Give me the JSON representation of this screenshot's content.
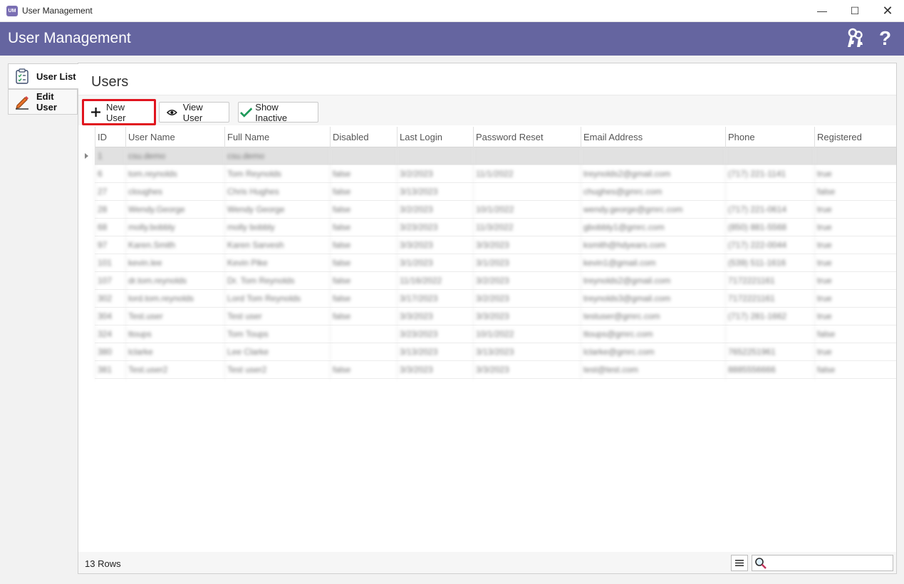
{
  "window": {
    "title": "User Management",
    "app_icon_text": "UM",
    "minimize_glyph": "—",
    "maximize_glyph": "☐",
    "close_glyph": "✕"
  },
  "header": {
    "title": "User Management",
    "keys_icon": "keys-icon",
    "help_glyph": "?"
  },
  "sidebar": {
    "tabs": [
      {
        "label": "User List",
        "icon": "clipboard-checklist-icon",
        "selected": true
      },
      {
        "label": "Edit User",
        "icon": "pencil-icon",
        "selected": false
      }
    ]
  },
  "main": {
    "title": "Users",
    "toolbar": {
      "new_user": "New User",
      "view_user": "View User",
      "show_inactive": "Show Inactive"
    },
    "columns": [
      "ID",
      "User Name",
      "Full Name",
      "Disabled",
      "Last Login",
      "Password Reset",
      "Email Address",
      "Phone",
      "Registered"
    ],
    "rows": [
      [
        "1",
        "csu.demo",
        "csu.demo",
        "",
        "",
        "",
        "",
        "",
        ""
      ],
      [
        "6",
        "tom.reynolds",
        "Tom Reynolds",
        "false",
        "3/2/2023",
        "11/1/2022",
        "treynolds2@gmail.com",
        "(717) 221-1141",
        "true"
      ],
      [
        "27",
        "cloughes",
        "Chris Hughes",
        "false",
        "3/13/2023",
        "",
        "chughes@gmrc.com",
        "",
        "false"
      ],
      [
        "28",
        "Wendy.George",
        "Wendy George",
        "false",
        "3/2/2023",
        "10/1/2022",
        "wendy.george@gmrc.com",
        "(717) 221-0614",
        "true"
      ],
      [
        "68",
        "molly.bobbly",
        "molly bobbly",
        "false",
        "3/23/2023",
        "11/3/2022",
        "gbobbly1@gmrc.com",
        "(850) 881-5568",
        "true"
      ],
      [
        "97",
        "Karen.Smith",
        "Karen Sarvesh",
        "false",
        "3/3/2023",
        "3/3/2023",
        "ksmith@hdyears.com",
        "(717) 222-0044",
        "true"
      ],
      [
        "101",
        "kevin.lee",
        "Kevin Pike",
        "false",
        "3/1/2023",
        "3/1/2023",
        "kevin1@gmail.com",
        "(539) 511-1616",
        "true"
      ],
      [
        "107",
        "dr.tom.reynolds",
        "Dr. Tom Reynolds",
        "false",
        "11/16/2022",
        "3/2/2023",
        "treynolds2@gmail.com",
        "7172221161",
        "true"
      ],
      [
        "302",
        "lord.tom.reynolds",
        "Lord Tom Reynolds",
        "false",
        "3/17/2023",
        "3/2/2023",
        "treynolds3@gmail.com",
        "7172221161",
        "true"
      ],
      [
        "304",
        "Test.user",
        "Test user",
        "false",
        "3/3/2023",
        "3/3/2023",
        "testuser@gmrc.com",
        "(717) 281-1662",
        "true"
      ],
      [
        "324",
        "ttoups",
        "Tom Toups",
        "",
        "3/23/2023",
        "10/1/2022",
        "ttoups@gmrc.com",
        "",
        "false"
      ],
      [
        "380",
        "lclarke",
        "Lee Clarke",
        "",
        "3/13/2023",
        "3/13/2023",
        "lclarke@gmrc.com",
        "7652251961",
        "true"
      ],
      [
        "381",
        "Test.user2",
        "Test user2",
        "false",
        "3/3/2023",
        "3/3/2023",
        "test@test.com",
        "8885556666",
        "false"
      ]
    ],
    "footer": {
      "row_count": "13 Rows",
      "column_chooser_icon": "list-icon",
      "search_icon": "search-icon",
      "search_value": ""
    }
  }
}
